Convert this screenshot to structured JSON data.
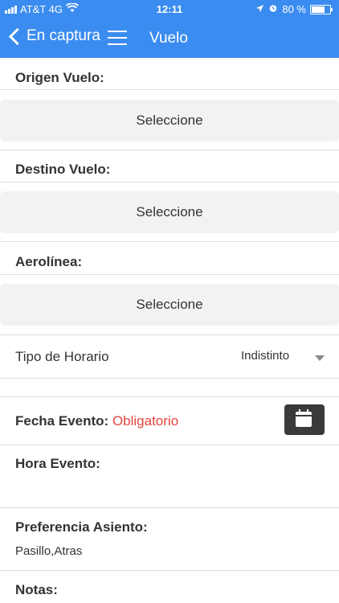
{
  "status_bar": {
    "carrier": "AT&T 4G",
    "time": "12:11",
    "battery": "80 %",
    "battery_level": 0.8
  },
  "nav": {
    "back_label": "En captura",
    "title": "Vuelo"
  },
  "form": {
    "origen_label": "Origen Vuelo:",
    "origen_value": "Seleccione",
    "destino_label": "Destino Vuelo:",
    "destino_value": "Seleccione",
    "aerolinea_label": "Aerolínea:",
    "aerolinea_value": "Seleccione",
    "tipo_horario_label": "Tipo de Horario",
    "tipo_horario_value": "Indistinto",
    "fecha_label": "Fecha Evento:",
    "fecha_required": "Obligatorio",
    "hora_label": "Hora Evento:",
    "preferencia_label": "Preferencia Asiento:",
    "preferencia_value": "Pasillo,Atras",
    "notas_label": "Notas:"
  },
  "colors": {
    "accent": "#3b8cf0",
    "required": "#e2463f",
    "calendar_button": "#3a3a3a"
  },
  "icons": [
    "back-chevron-icon",
    "hamburger-menu-icon",
    "calendar-icon",
    "dropdown-caret-icon"
  ]
}
